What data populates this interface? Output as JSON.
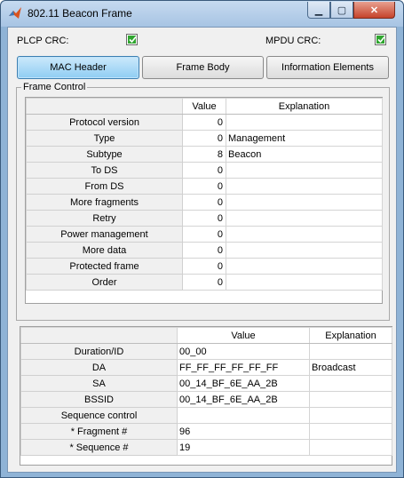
{
  "window": {
    "title": "802.11 Beacon Frame",
    "min_icon": "minimize-icon",
    "max_icon": "maximize-icon",
    "close_icon": "close-icon",
    "min_glyph": "▁",
    "max_glyph": "▢",
    "close_glyph": "✕"
  },
  "crc": {
    "plcp_label": "PLCP CRC:",
    "mpdu_label": "MPDU CRC:",
    "plcp_checked": true,
    "mpdu_checked": true,
    "check_color": "#2fa52f"
  },
  "tabs": [
    {
      "label": "MAC Header",
      "active": true
    },
    {
      "label": "Frame Body",
      "active": false
    },
    {
      "label": "Information Elements",
      "active": false
    }
  ],
  "frame_control": {
    "title": "Frame Control",
    "headers": [
      "Value",
      "Explanation"
    ],
    "rows": [
      {
        "name": "Protocol version",
        "value": "0",
        "explanation": ""
      },
      {
        "name": "Type",
        "value": "0",
        "explanation": "Management"
      },
      {
        "name": "Subtype",
        "value": "8",
        "explanation": "Beacon"
      },
      {
        "name": "To DS",
        "value": "0",
        "explanation": ""
      },
      {
        "name": "From DS",
        "value": "0",
        "explanation": ""
      },
      {
        "name": "More fragments",
        "value": "0",
        "explanation": ""
      },
      {
        "name": "Retry",
        "value": "0",
        "explanation": ""
      },
      {
        "name": "Power management",
        "value": "0",
        "explanation": ""
      },
      {
        "name": "More data",
        "value": "0",
        "explanation": ""
      },
      {
        "name": "Protected frame",
        "value": "0",
        "explanation": ""
      },
      {
        "name": "Order",
        "value": "0",
        "explanation": ""
      }
    ]
  },
  "mac_fields": {
    "headers": [
      "Value",
      "Explanation"
    ],
    "rows": [
      {
        "name": "Duration/ID",
        "value": "00_00",
        "explanation": ""
      },
      {
        "name": "DA",
        "value": "FF_FF_FF_FF_FF_FF",
        "explanation": "Broadcast"
      },
      {
        "name": "SA",
        "value": "00_14_BF_6E_AA_2B",
        "explanation": ""
      },
      {
        "name": "BSSID",
        "value": "00_14_BF_6E_AA_2B",
        "explanation": ""
      },
      {
        "name": "Sequence control",
        "value": "",
        "explanation": ""
      },
      {
        "name": "* Fragment #",
        "value": "96",
        "explanation": ""
      },
      {
        "name": "* Sequence #",
        "value": "19",
        "explanation": ""
      }
    ]
  },
  "colors": {
    "active_tab": "#8fcdf3",
    "window_frame": "#8fb3d6"
  }
}
